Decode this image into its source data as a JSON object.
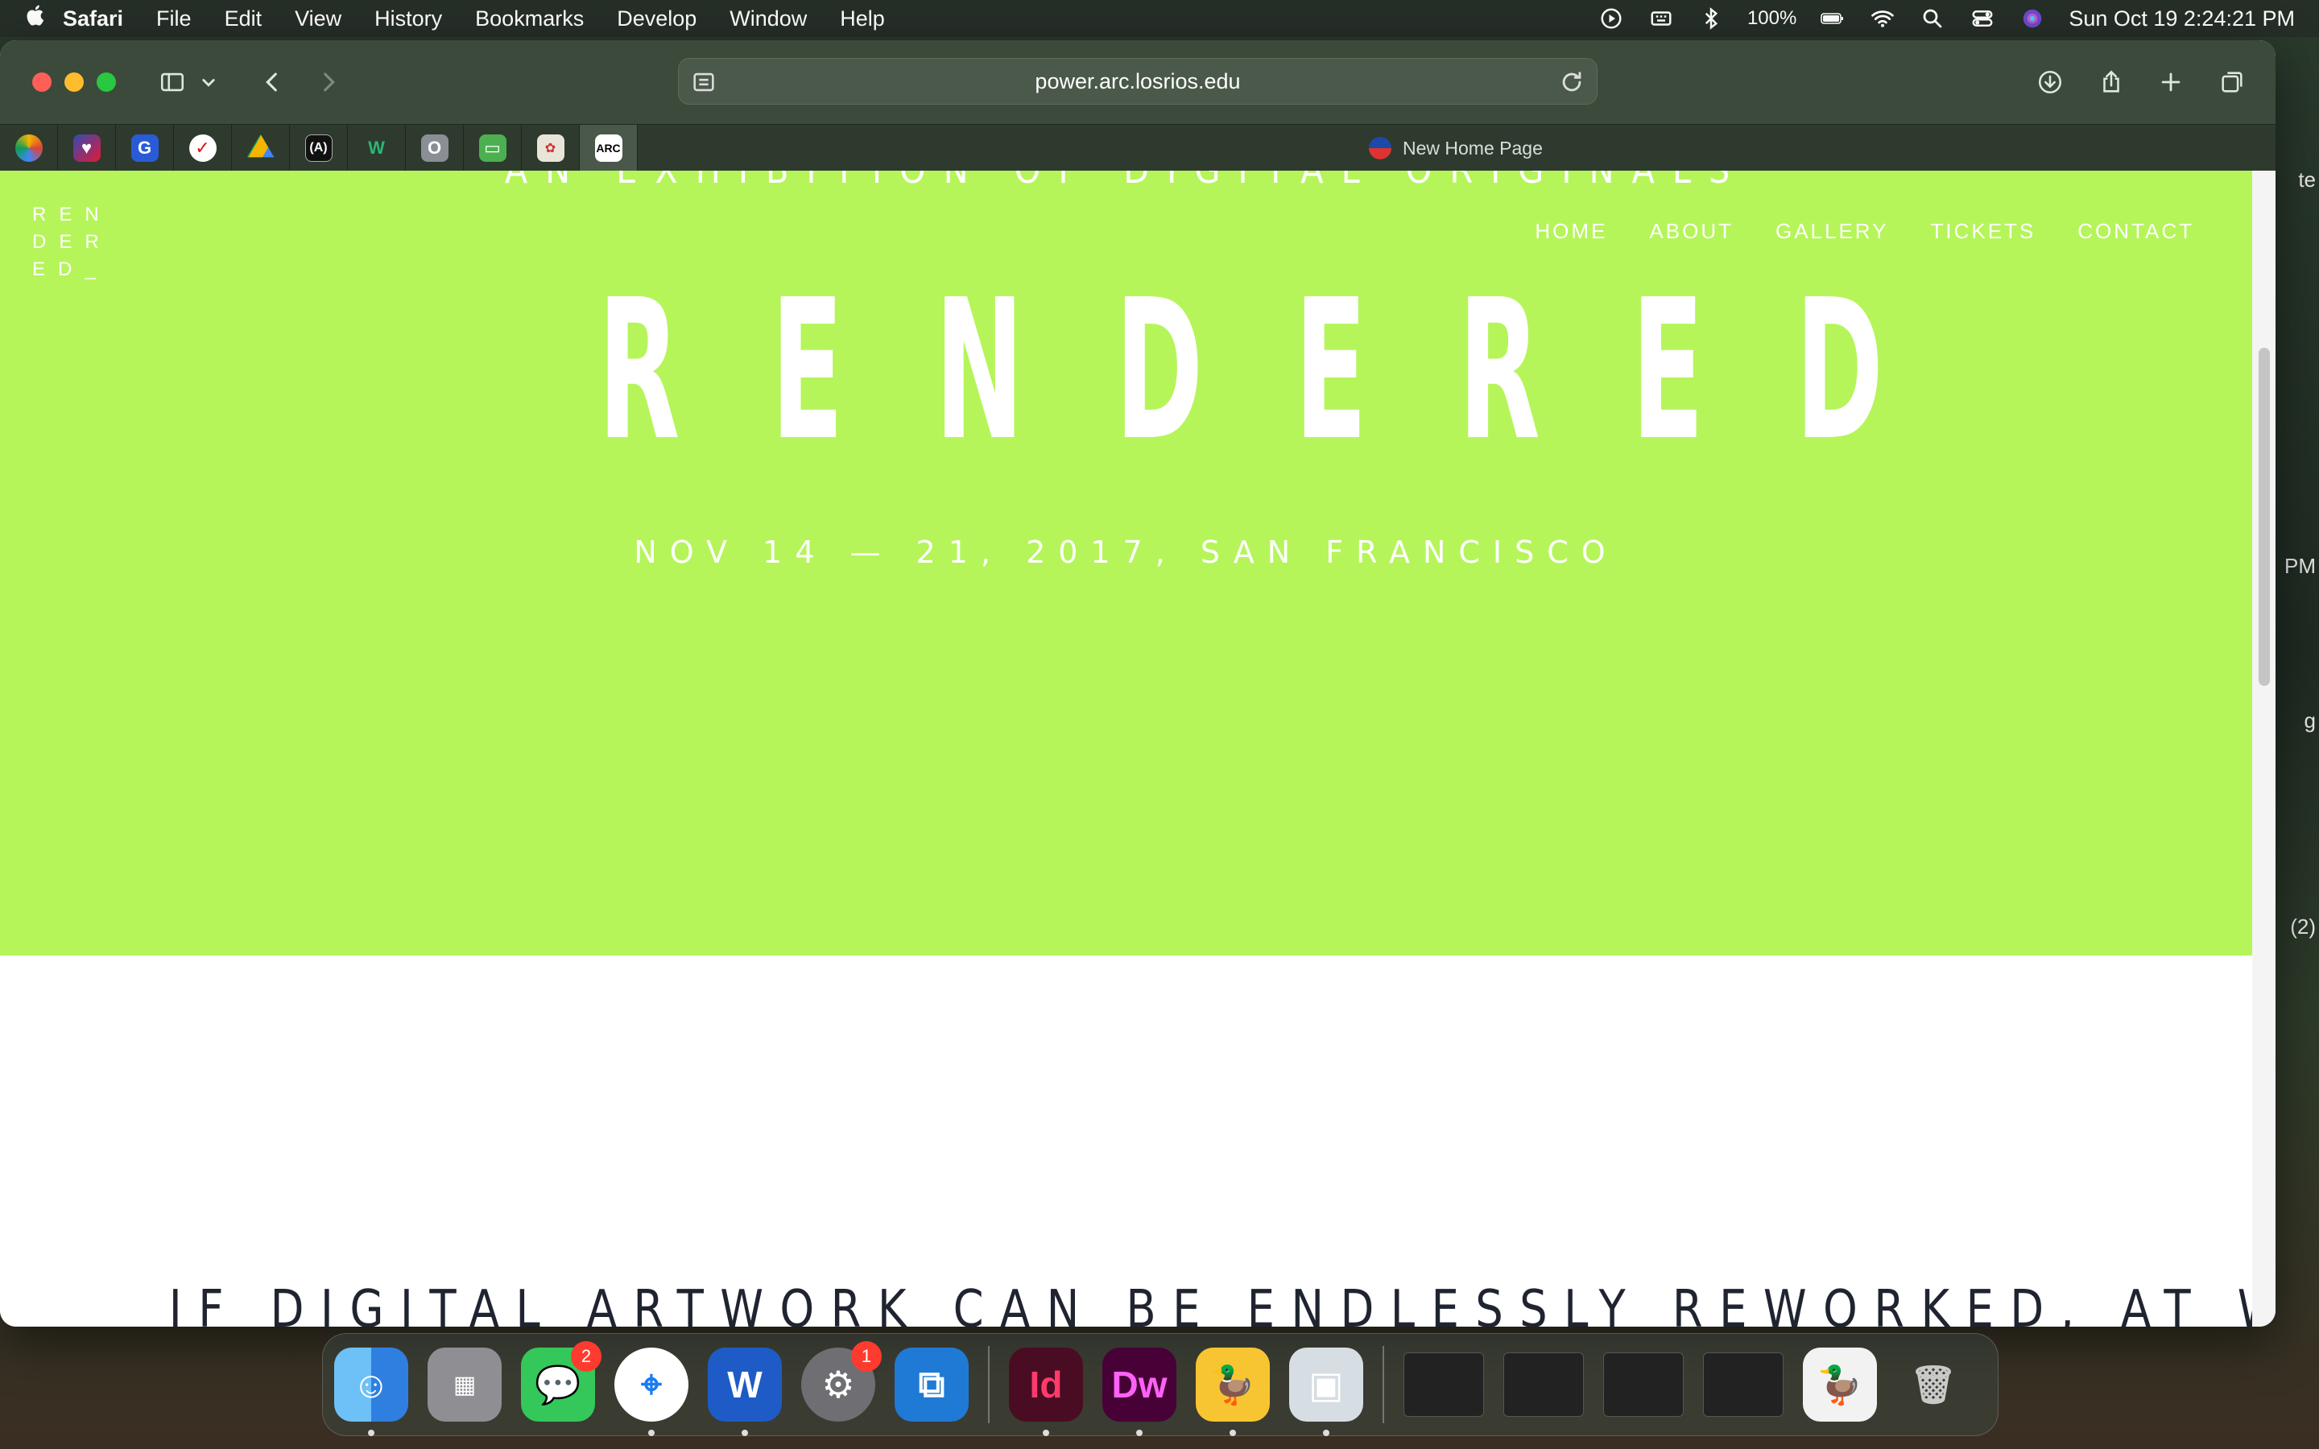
{
  "menubar": {
    "app_name": "Safari",
    "items": [
      "File",
      "Edit",
      "View",
      "History",
      "Bookmarks",
      "Develop",
      "Window",
      "Help"
    ],
    "battery": "100%",
    "clock": "Sun Oct 19  2:24:21 PM"
  },
  "desktop": {
    "edge_texts": [
      "te",
      "PM",
      "g",
      "(2)"
    ]
  },
  "browser": {
    "url": "power.arc.losrios.edu",
    "tab_title": "New Home Page",
    "favorites_count": 11
  },
  "page": {
    "kicker": "AN EXHIBITION OF DIGITAL ORIGINALS",
    "logo_lines": [
      "REN",
      "DER",
      "ED_"
    ],
    "nav": [
      "HOME",
      "ABOUT",
      "GALLERY",
      "TICKETS",
      "CONTACT"
    ],
    "title": "RENDERED",
    "date": "NOV 14 — 21, 2017, SAN FRANCISCO",
    "statement": "IF DIGITAL ARTWORK CAN BE ENDLESSLY REWORKED, AT WHAT",
    "accent_color": "#b5f55a"
  },
  "dock": {
    "messages_badge": "2",
    "settings_badge": "1",
    "indesign_label": "Id",
    "dreamweaver_label": "Dw"
  }
}
